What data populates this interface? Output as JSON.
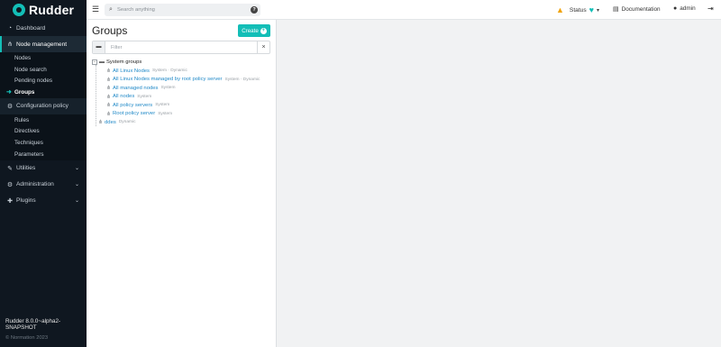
{
  "brand": {
    "name": "Rudder"
  },
  "sidebar": {
    "items": [
      {
        "label": "Dashboard",
        "icon": "dashboard-icon"
      },
      {
        "label": "Node management",
        "icon": "sitemap-icon",
        "active": true
      },
      {
        "label": "Configuration policy",
        "icon": "gears-icon"
      },
      {
        "label": "Utilities",
        "icon": "wrench-icon"
      },
      {
        "label": "Administration",
        "icon": "gear-icon"
      },
      {
        "label": "Plugins",
        "icon": "puzzle-icon"
      }
    ],
    "node_management_sub": [
      "Nodes",
      "Node search",
      "Pending nodes",
      "Groups"
    ],
    "configuration_sub": [
      "Rules",
      "Directives",
      "Techniques",
      "Parameters"
    ],
    "version": "Rudder 8.0.0~alpha2-SNAPSHOT",
    "copyright": "© Normation 2023"
  },
  "topbar": {
    "search_placeholder": "Search anything",
    "help": "?",
    "status_label": "Status",
    "documentation_label": "Documentation",
    "user_label": "admin"
  },
  "groups": {
    "title": "Groups",
    "create_label": "Create",
    "filter_placeholder": "Filter",
    "tree": {
      "category": "System groups",
      "children": [
        {
          "name": "All Linux Nodes",
          "tags": "System · Dynamic"
        },
        {
          "name": "All Linux Nodes managed by root policy server",
          "tags": "System · Dynamic"
        },
        {
          "name": "All managed nodes",
          "tags": "System"
        },
        {
          "name": "All nodes",
          "tags": "System"
        },
        {
          "name": "All policy servers",
          "tags": "System"
        },
        {
          "name": "Root policy server",
          "tags": "System"
        }
      ],
      "root_group": {
        "name": "ddes",
        "tags": "Dynamic"
      }
    }
  },
  "colors": {
    "accent": "#13beb7",
    "sidebar_bg": "#0f1720",
    "link": "#1e88c7",
    "warning": "#f0a30a"
  }
}
